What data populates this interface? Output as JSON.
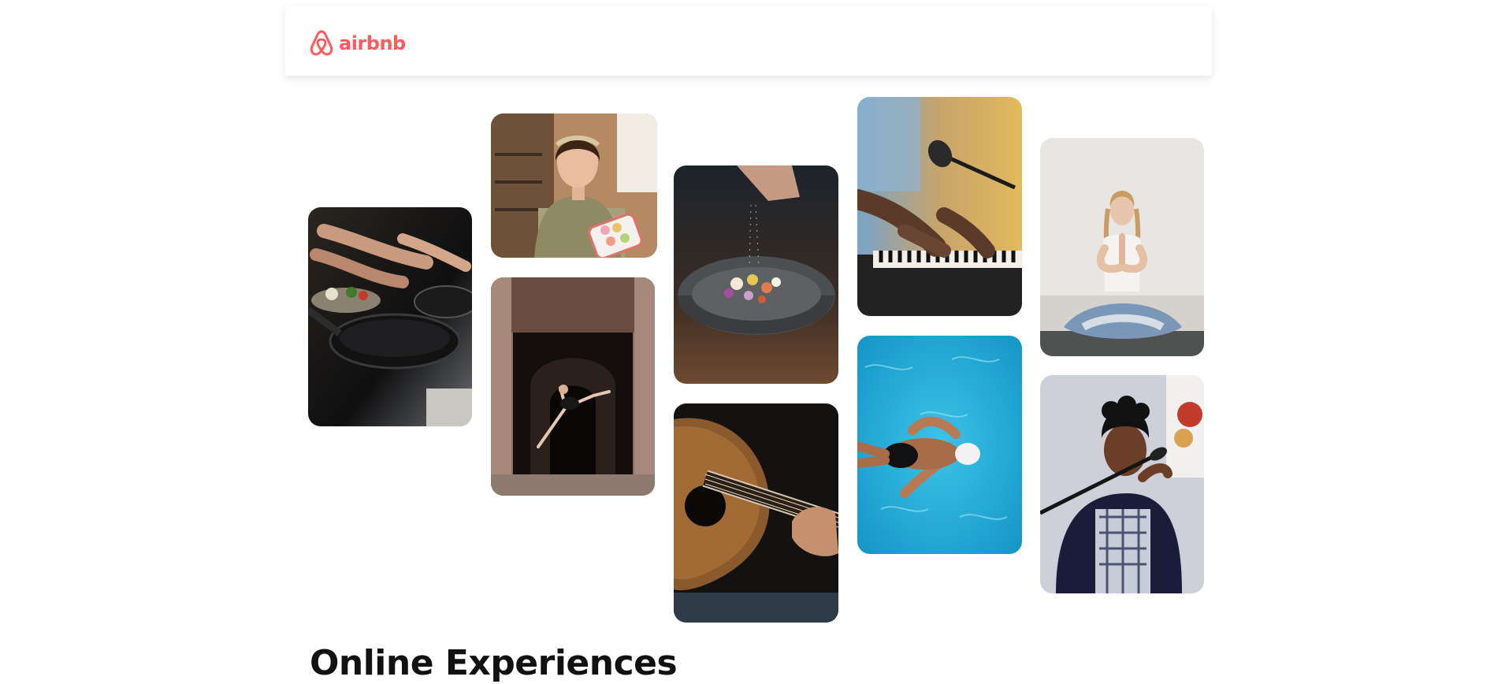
{
  "brand": {
    "name": "airbnb",
    "color": "#FF5A5F",
    "icon": "airbnb-logo-icon"
  },
  "gallery": [
    {
      "name": "cooking-photo",
      "description": "Hands preparing food next to a black frying pan"
    },
    {
      "name": "macarons-photo",
      "description": "Woman holding a box of macarons in a kitchen"
    },
    {
      "name": "dancer-photo",
      "description": "Ballet dancer leaping in front of an ornate doorway"
    },
    {
      "name": "salad-bowl-photo",
      "description": "Chef sprinkling salt over a stone bowl of food"
    },
    {
      "name": "guitar-photo",
      "description": "Close-up of hands playing an acoustic guitar"
    },
    {
      "name": "piano-photo",
      "description": "Hands playing a keyboard in front of a microphone"
    },
    {
      "name": "swimmer-photo",
      "description": "Swimmer in a white cap in a blue pool"
    },
    {
      "name": "yoga-photo",
      "description": "Woman meditating cross-legged in a bright room"
    },
    {
      "name": "singer-photo",
      "description": "Singer with eyes closed performing at a microphone"
    }
  ],
  "section": {
    "title": "Online Experiences"
  }
}
